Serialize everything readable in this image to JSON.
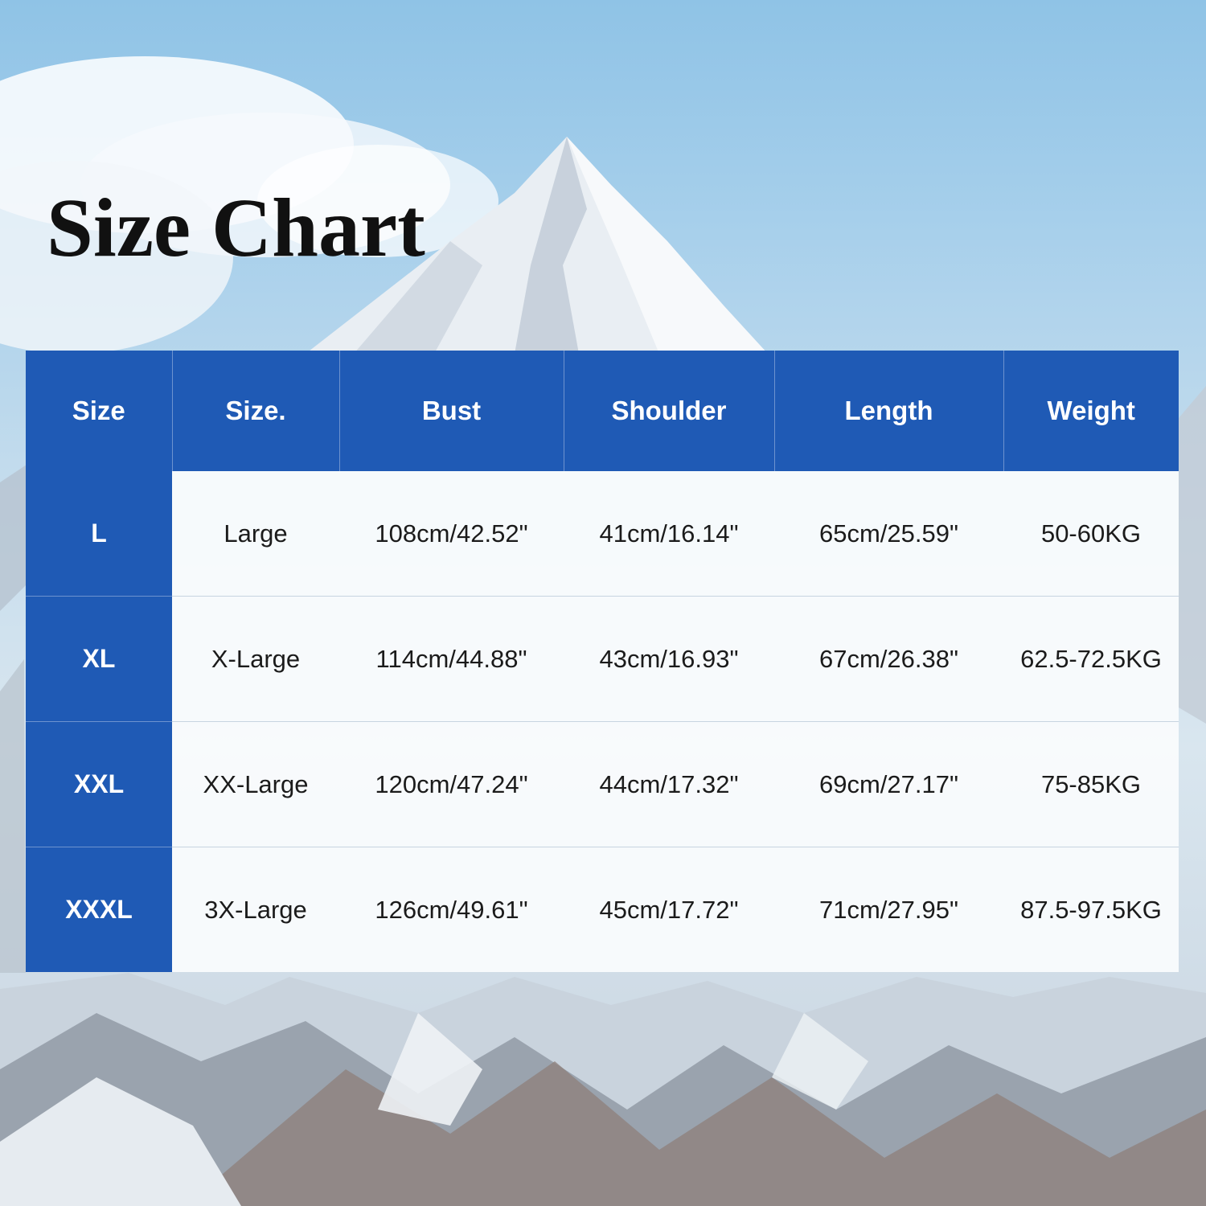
{
  "chart_data": {
    "type": "table",
    "title": "Size Chart",
    "columns": [
      "Size",
      "Size.",
      "Bust",
      "Shoulder",
      "Length",
      "Weight"
    ],
    "rows": [
      [
        "L",
        "Large",
        "108cm/42.52\"",
        "41cm/16.14\"",
        "65cm/25.59\"",
        "50-60KG"
      ],
      [
        "XL",
        "X-Large",
        "114cm/44.88\"",
        "43cm/16.93\"",
        "67cm/26.38\"",
        "62.5-72.5KG"
      ],
      [
        "XXL",
        "XX-Large",
        "120cm/47.24\"",
        "44cm/17.32\"",
        "69cm/27.17\"",
        "75-85KG"
      ],
      [
        "XXXL",
        "3X-Large",
        "126cm/49.61\"",
        "45cm/17.72\"",
        "71cm/27.95\"",
        "87.5-97.5KG"
      ]
    ]
  },
  "colors": {
    "header_blue": "#1f5ab5",
    "cell_background": "#fafcfd",
    "title_text": "#111111"
  }
}
